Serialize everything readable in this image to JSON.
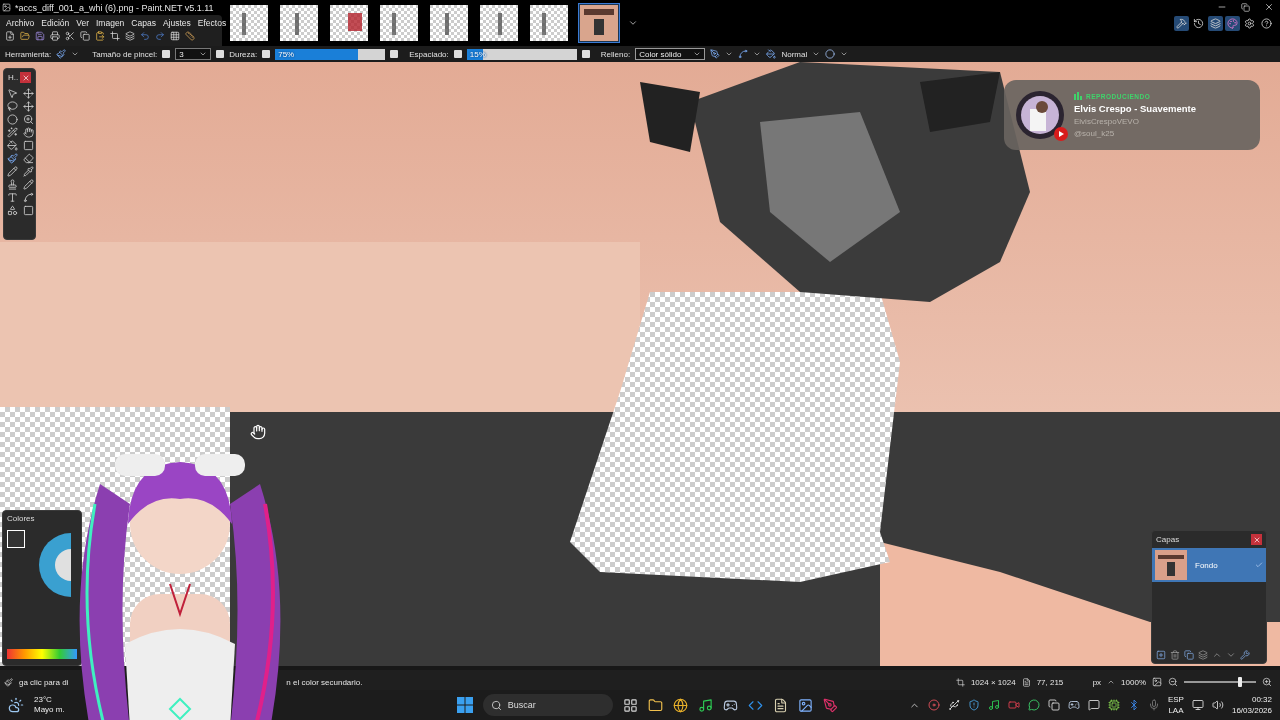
{
  "window": {
    "title": "*accs_diff_001_a_whi (6).png - Paint.NET v5.1.11"
  },
  "menu": [
    "Archivo",
    "Edición",
    "Ver",
    "Imagen",
    "Capas",
    "Ajustes",
    "Efectos"
  ],
  "image_tabs": [
    {
      "kind": "picture",
      "selected": false
    },
    {
      "kind": "picture",
      "selected": false
    },
    {
      "kind": "picture",
      "selected": false
    },
    {
      "kind": "picture",
      "selected": false
    },
    {
      "kind": "picture",
      "selected": false
    },
    {
      "kind": "picture",
      "selected": false
    },
    {
      "kind": "picture",
      "selected": false
    },
    {
      "kind": "picture",
      "selected": true
    }
  ],
  "tool_options": {
    "tool_label": "Herramienta:",
    "brush_size_label": "Tamaño de pincel:",
    "brush_size": "3",
    "hardness_label": "Dureza:",
    "hardness": {
      "reading": "75%",
      "level": 0.75
    },
    "spacing_label": "Espaciado:",
    "spacing": {
      "reading": "15%",
      "level": 0.15
    },
    "fill_label": "Relleno:",
    "fill": "Color sólido",
    "blend_mode": "Normal"
  },
  "tools_panel": {
    "title": "H.."
  },
  "colors_panel": {
    "title": "Colores"
  },
  "now_playing": {
    "status": "REPRODUCIENDO",
    "title": "Elvis Crespo - Suavemente",
    "channel": "ElvisCrespoVEVO",
    "user": "@soul_k25"
  },
  "layers_panel": {
    "title": "Capas",
    "layers": [
      {
        "name": "Fondo",
        "selected": true,
        "visible": true
      }
    ]
  },
  "status_bar": {
    "hint_start": "ga clic para di",
    "hint_end": "n el color secundario.",
    "image_size": "1024 × 1024",
    "cursor_position": "77, 215",
    "units": "px",
    "zoom": "1000%",
    "zoom_slider": {
      "level": 0.78
    }
  },
  "taskbar": {
    "temperature": "23°C",
    "weather_caption": "Mayo m.",
    "search": {
      "placeholder": "Buscar"
    },
    "language": "ESP",
    "region": "LAA",
    "time": "00:32",
    "date": "16/03/2026"
  }
}
